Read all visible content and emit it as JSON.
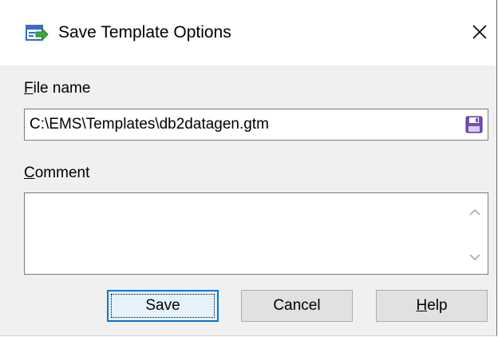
{
  "dialog": {
    "title": "Save Template Options",
    "title_icon": "save-template-icon",
    "close_icon": "close-icon"
  },
  "file_name": {
    "label_mnemonic": "F",
    "label_rest": "ile name",
    "value": "C:\\EMS\\Templates\\db2datagen.gtm",
    "browse_icon": "floppy-disk-icon"
  },
  "comment": {
    "label_mnemonic": "C",
    "label_rest": "omment",
    "value": ""
  },
  "buttons": {
    "save": "Save",
    "cancel": "Cancel",
    "help_mnemonic": "H",
    "help_rest": "elp"
  },
  "colors": {
    "accent": "#0078d7",
    "icon_green": "#3aa845",
    "icon_blue": "#2f6fc8",
    "floppy_purple": "#7a4ab8"
  }
}
